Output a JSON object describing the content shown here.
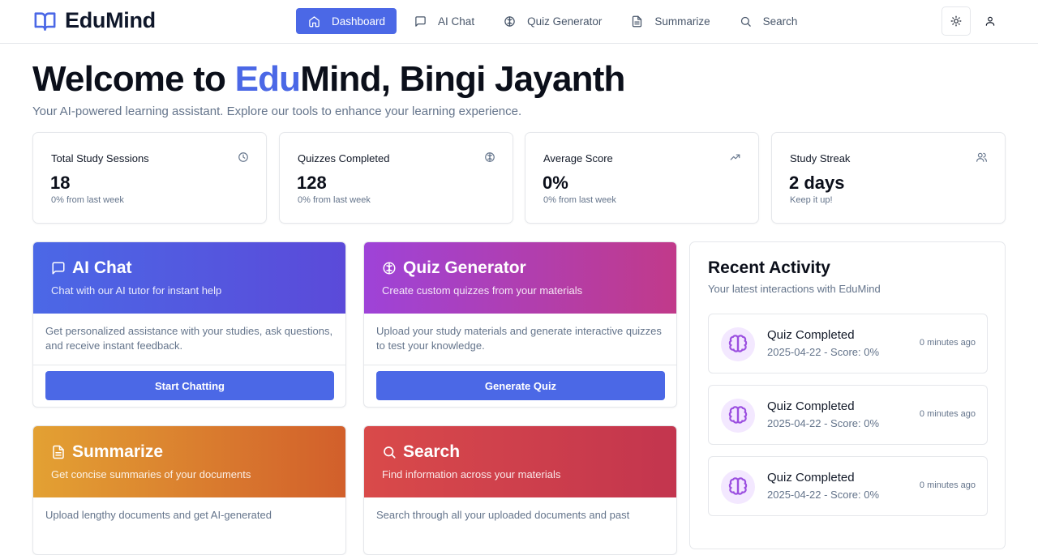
{
  "brand": {
    "name": "EduMind"
  },
  "nav": [
    {
      "label": "Dashboard",
      "icon": "home-icon",
      "active": true
    },
    {
      "label": "AI Chat",
      "icon": "message-square-icon",
      "active": false
    },
    {
      "label": "Quiz Generator",
      "icon": "brain-icon",
      "active": false
    },
    {
      "label": "Summarize",
      "icon": "file-text-icon",
      "active": false
    },
    {
      "label": "Search",
      "icon": "search-icon",
      "active": false
    }
  ],
  "header_actions": {
    "theme_icon": "sun-icon",
    "user_icon": "user-icon"
  },
  "welcome": {
    "prefix": "Welcome to ",
    "accent": "Edu",
    "rest": "Mind, Bingi Jayanth",
    "subtitle": "Your AI-powered learning assistant. Explore our tools to enhance your learning experience."
  },
  "stats": [
    {
      "title": "Total Study Sessions",
      "value": "18",
      "sub": "0% from last week",
      "icon": "clock-icon"
    },
    {
      "title": "Quizzes Completed",
      "value": "128",
      "sub": "0% from last week",
      "icon": "brain-icon"
    },
    {
      "title": "Average Score",
      "value": "0%",
      "sub": "0% from last week",
      "icon": "trending-up-icon"
    },
    {
      "title": "Study Streak",
      "value": "2 days",
      "sub": "Keep it up!",
      "icon": "users-icon"
    }
  ],
  "cards": [
    {
      "title": "AI Chat",
      "desc": "Chat with our AI tutor for instant help",
      "body": "Get personalized assistance with your studies, ask questions, and receive instant feedback.",
      "button": "Start Chatting",
      "icon": "message-square-icon"
    },
    {
      "title": "Quiz Generator",
      "desc": "Create custom quizzes from your materials",
      "body": "Upload your study materials and generate interactive quizzes to test your knowledge.",
      "button": "Generate Quiz",
      "icon": "brain-icon"
    },
    {
      "title": "Summarize",
      "desc": "Get concise summaries of your documents",
      "body": "Upload lengthy documents and get AI-generated",
      "button": "",
      "icon": "file-text-icon"
    },
    {
      "title": "Search",
      "desc": "Find information across your materials",
      "body": "Search through all your uploaded documents and past",
      "button": "",
      "icon": "search-icon"
    }
  ],
  "activity": {
    "title": "Recent Activity",
    "subtitle": "Your latest interactions with EduMind",
    "items": [
      {
        "name": "Quiz Completed",
        "detail": "2025-04-22 - Score: 0%",
        "time": "0 minutes ago",
        "icon": "brain-icon"
      },
      {
        "name": "Quiz Completed",
        "detail": "2025-04-22 - Score: 0%",
        "time": "0 minutes ago",
        "icon": "brain-icon"
      },
      {
        "name": "Quiz Completed",
        "detail": "2025-04-22 - Score: 0%",
        "time": "0 minutes ago",
        "icon": "brain-icon"
      }
    ]
  },
  "colors": {
    "primary": "#4b68e6",
    "text": "#0f172a",
    "muted": "#64748b",
    "border": "#e5e7eb"
  }
}
